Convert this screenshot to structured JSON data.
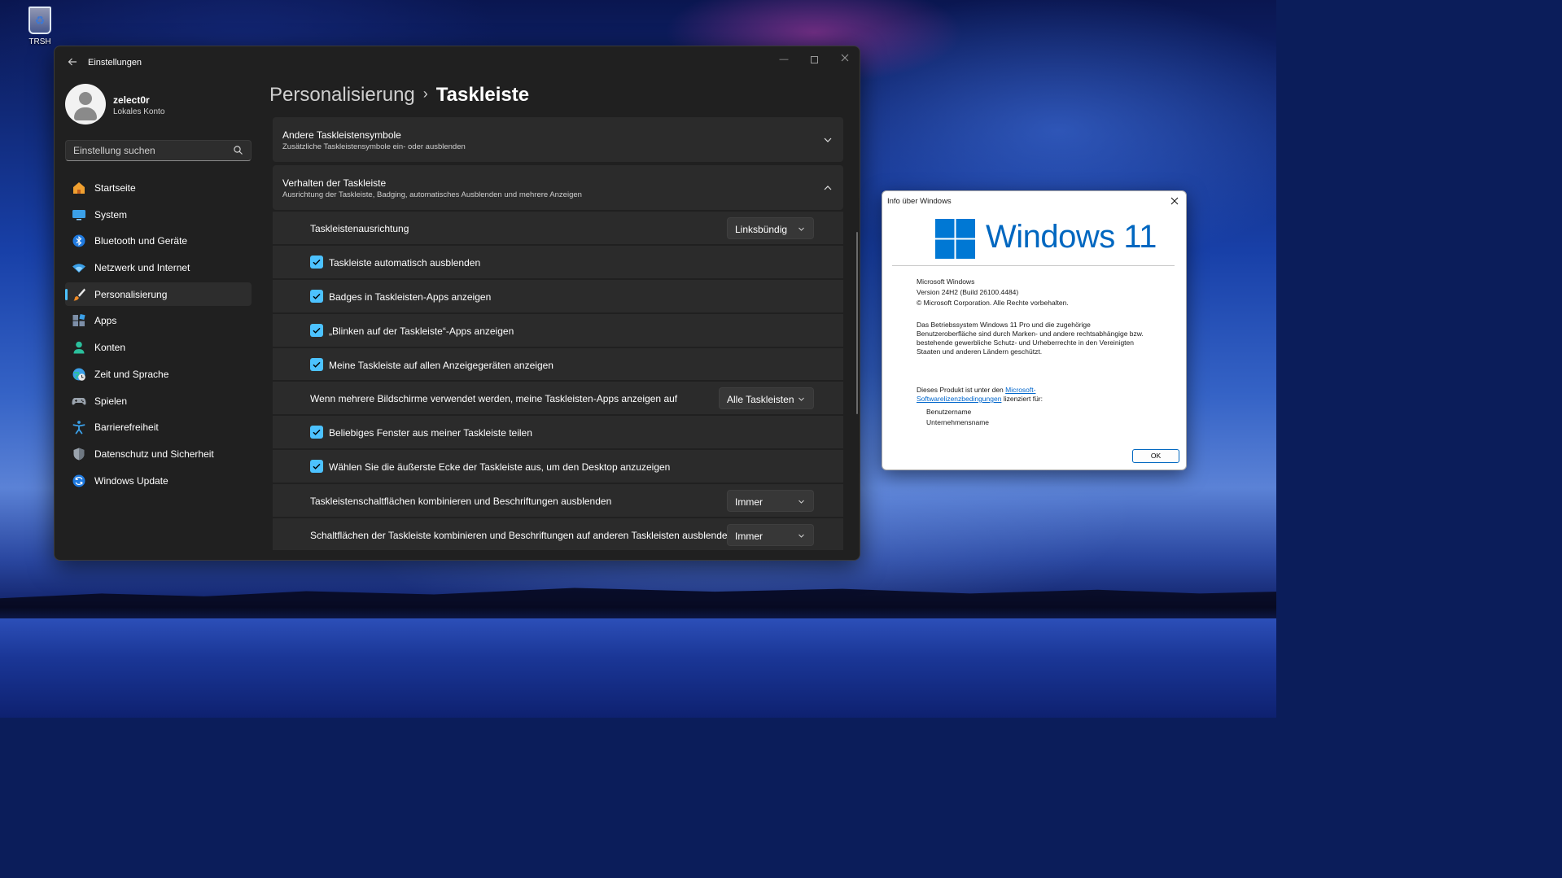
{
  "desktop": {
    "recycle_bin_label": "TRSH"
  },
  "settings": {
    "window_title": "Einstellungen",
    "user": {
      "name": "zelect0r",
      "account_type": "Lokales Konto"
    },
    "search": {
      "placeholder": "Einstellung suchen"
    },
    "nav": [
      {
        "label": "Startseite",
        "icon": "home-icon"
      },
      {
        "label": "System",
        "icon": "monitor-icon"
      },
      {
        "label": "Bluetooth und Geräte",
        "icon": "bluetooth-icon"
      },
      {
        "label": "Netzwerk und Internet",
        "icon": "wifi-icon"
      },
      {
        "label": "Personalisierung",
        "icon": "paintbrush-icon",
        "active": true
      },
      {
        "label": "Apps",
        "icon": "apps-icon"
      },
      {
        "label": "Konten",
        "icon": "person-icon"
      },
      {
        "label": "Zeit und Sprache",
        "icon": "globe-clock-icon"
      },
      {
        "label": "Spielen",
        "icon": "gamepad-icon"
      },
      {
        "label": "Barrierefreiheit",
        "icon": "accessibility-icon"
      },
      {
        "label": "Datenschutz und Sicherheit",
        "icon": "shield-icon"
      },
      {
        "label": "Windows Update",
        "icon": "update-icon"
      }
    ],
    "breadcrumb": {
      "parent": "Personalisierung",
      "separator": "›",
      "current": "Taskleiste"
    },
    "sections": {
      "other_icons": {
        "title": "Andere Taskleistensymbole",
        "subtitle": "Zusätzliche Taskleistensymbole ein- oder ausblenden",
        "expanded": false
      },
      "behavior": {
        "title": "Verhalten der Taskleiste",
        "subtitle": "Ausrichtung der Taskleiste, Badging, automatisches Ausblenden und mehrere Anzeigen",
        "expanded": true
      }
    },
    "behavior_rows": {
      "alignment": {
        "label": "Taskleistenausrichtung",
        "value": "Linksbündig"
      },
      "autohide": {
        "label": "Taskleiste automatisch ausblenden",
        "checked": true
      },
      "badges": {
        "label": "Badges in Taskleisten-Apps anzeigen",
        "checked": true
      },
      "flashing": {
        "label": "„Blinken auf der Taskleiste“-Apps anzeigen",
        "checked": true
      },
      "all_displays": {
        "label": "Meine Taskleiste auf allen Anzeigegeräten anzeigen",
        "checked": true
      },
      "multi_display_apps": {
        "label": "Wenn mehrere Bildschirme verwendet werden, meine Taskleisten-Apps anzeigen auf",
        "value": "Alle Taskleisten"
      },
      "share_window": {
        "label": "Beliebiges Fenster aus meiner Taskleiste teilen",
        "checked": true
      },
      "far_corner": {
        "label": "Wählen Sie die äußerste Ecke der Taskleiste aus, um den Desktop anzuzeigen",
        "checked": true
      },
      "combine": {
        "label": "Taskleistenschaltflächen kombinieren und Beschriftungen ausblenden",
        "value": "Immer"
      },
      "combine_other": {
        "label": "Schaltflächen der Taskleiste kombinieren und Beschriftungen auf anderen Taskleisten ausblenden",
        "value": "Immer"
      }
    },
    "colors": {
      "accent": "#4cc2ff",
      "window_bg": "#202020",
      "card_bg": "#2b2b2b"
    }
  },
  "winver": {
    "title": "Info über Windows",
    "brand": "Windows 11",
    "product": "Microsoft Windows",
    "version": "Version 24H2 (Build 26100.4484)",
    "copyright": "© Microsoft Corporation. Alle Rechte vorbehalten.",
    "legal": [
      "Das Betriebssystem Windows 11 Pro und die zugehörige",
      "Benutzeroberfläche sind durch Marken- und andere rechtsabhängige bzw.",
      "bestehende gewerbliche Schutz- und Urheberrechte in den Vereinigten",
      "Staaten und anderen Ländern geschützt."
    ],
    "license_prefix": "Dieses Produkt ist unter den",
    "license_link_1": "Microsoft-",
    "license_link_2": "Softwarelizenzbedingungen",
    "license_suffix": "lizenziert für:",
    "user_name": "Benutzername",
    "org_name": "Unternehmensname",
    "ok_label": "OK",
    "colors": {
      "brand": "#0067c0"
    }
  }
}
